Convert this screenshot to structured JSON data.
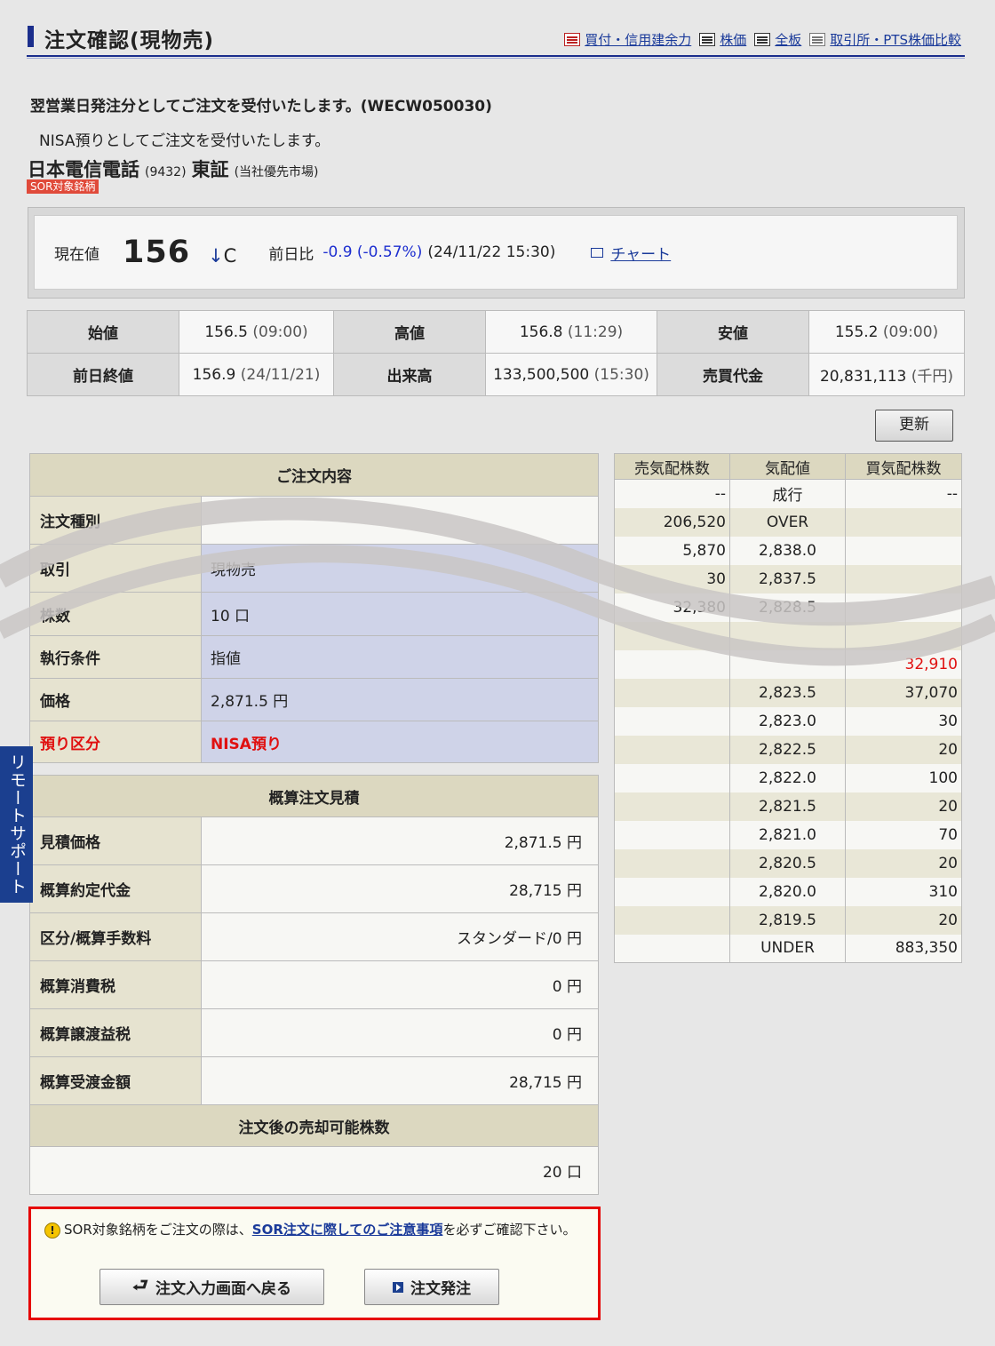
{
  "header": {
    "title": "注文確認(現物売)",
    "links": [
      "買付・信用建余力",
      "株価",
      "全板",
      "取引所・PTS株価比較"
    ]
  },
  "messages": {
    "line1": "翌営業日発注分としてご注文を受付いたします。(WECW050030)",
    "line2": "NISA預りとしてご注文を受付いたします。"
  },
  "stock": {
    "name": "日本電信電話",
    "code": "(9432)",
    "exchange": "東証",
    "market_note": "(当社優先市場)",
    "sor_badge": "SOR対象銘柄"
  },
  "price": {
    "current_label": "現在値",
    "current": "156",
    "arrow": "↓",
    "flag": "C",
    "prev_label": "前日比",
    "diff": "-0.9 (-0.57%)",
    "date": "(24/11/22 15:30)",
    "chart_link": "チャート"
  },
  "stats": {
    "open_label": "始値",
    "open": "156.5",
    "open_time": "(09:00)",
    "high_label": "高値",
    "high": "156.8",
    "high_time": "(11:29)",
    "low_label": "安値",
    "low": "155.2",
    "low_time": "(09:00)",
    "prev_close_label": "前日終値",
    "prev_close": "156.9",
    "prev_close_date": "(24/11/21)",
    "volume_label": "出来高",
    "volume": "133,500,500",
    "volume_time": "(15:30)",
    "turnover_label": "売買代金",
    "turnover": "20,831,113",
    "turnover_unit": "(千円)"
  },
  "refresh_label": "更新",
  "order": {
    "section": "ご注文内容",
    "rows": [
      {
        "label": "注文種別",
        "value": ""
      },
      {
        "label": "取引",
        "value": "現物売"
      },
      {
        "label": "株数",
        "value": "10 口"
      },
      {
        "label": "執行条件",
        "value": "指値"
      },
      {
        "label": "価格",
        "value": "2,871.5 円"
      },
      {
        "label": "預り区分",
        "value": "NISA預り"
      }
    ]
  },
  "estimate": {
    "section": "概算注文見積",
    "rows": [
      {
        "label": "見積価格",
        "value": "2,871.5 円"
      },
      {
        "label": "概算約定代金",
        "value": "28,715 円"
      },
      {
        "label": "区分/概算手数料",
        "value": "スタンダード/0 円"
      },
      {
        "label": "概算消費税",
        "value": "0 円"
      },
      {
        "label": "概算譲渡益税",
        "value": "0 円"
      },
      {
        "label": "概算受渡金額",
        "value": "28,715 円"
      }
    ],
    "after_section": "注文後の売却可能株数",
    "after_value": "20 口"
  },
  "board": {
    "headers": [
      "売気配株数",
      "気配値",
      "買気配株数"
    ],
    "rows": [
      {
        "sell": "--",
        "price": "成行",
        "buy": "--"
      },
      {
        "sell": "206,520",
        "price": "OVER",
        "buy": ""
      },
      {
        "sell": "5,870",
        "price": "2,838.0",
        "buy": ""
      },
      {
        "sell": "30",
        "price": "2,837.5",
        "buy": ""
      },
      {
        "sell": "32,380",
        "price": "2,828.5",
        "buy": ""
      },
      {
        "sell": "",
        "price": "",
        "buy": ""
      },
      {
        "sell": "",
        "price": "",
        "buy": "32,910"
      },
      {
        "sell": "",
        "price": "2,823.5",
        "buy": "37,070"
      },
      {
        "sell": "",
        "price": "2,823.0",
        "buy": "30"
      },
      {
        "sell": "",
        "price": "2,822.5",
        "buy": "20"
      },
      {
        "sell": "",
        "price": "2,822.0",
        "buy": "100"
      },
      {
        "sell": "",
        "price": "2,821.5",
        "buy": "20"
      },
      {
        "sell": "",
        "price": "2,821.0",
        "buy": "70"
      },
      {
        "sell": "",
        "price": "2,820.5",
        "buy": "20"
      },
      {
        "sell": "",
        "price": "2,820.0",
        "buy": "310"
      },
      {
        "sell": "",
        "price": "2,819.5",
        "buy": "20"
      },
      {
        "sell": "",
        "price": "UNDER",
        "buy": "883,350"
      }
    ]
  },
  "remote_support": "リモートサポート",
  "notice": {
    "pre": "SOR対象銘柄をご注文の際は、",
    "link": "SOR注文に際してのご注意事項",
    "post": "を必ずご確認下さい。"
  },
  "buttons": {
    "back": "注文入力画面へ戻る",
    "send": "注文発注"
  },
  "colors": {
    "accent_navy": "#1b2e8c",
    "down_blue": "#1e2fd0",
    "alert_red": "#e60000"
  }
}
